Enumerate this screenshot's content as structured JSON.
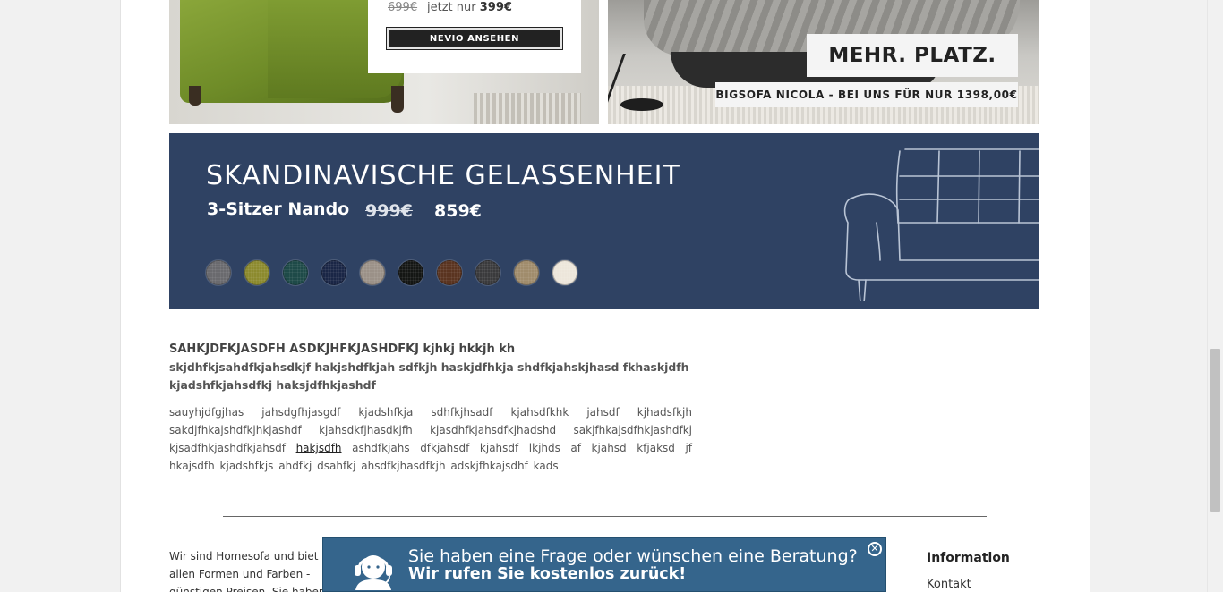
{
  "banner_left": {
    "old_price": "699€",
    "price_prefix": "jetzt nur",
    "price": "399€",
    "button_label": "NEVIO ANSEHEN"
  },
  "banner_right": {
    "headline": "MEHR. PLATZ.",
    "subline": "BIGSOFA NICOLA - BEI UNS FÜR NUR 1398,00€"
  },
  "blue_banner": {
    "title": "SKANDINAVISCHE GELASSENHEIT",
    "product": "3-Sitzer Nando",
    "old_price": "999€",
    "new_price": "859€",
    "swatch_colors": [
      "#6a6a6e",
      "#8c8a2e",
      "#1e4a48",
      "#1a2646",
      "#9b9188",
      "#141614",
      "#5a3420",
      "#3a3a3c",
      "#a08c6c",
      "#ede6db"
    ]
  },
  "content": {
    "heading": "SAHKJDFKJASDFH ASDKJHFKJASHDFKJ kjhkj hkkjh kh",
    "subheading": "skjdhfkjsahdfkjahsdkjf hakjshdfkjah sdfkjh haskjdfhkja shdfkjahskjhasd fkhaskjdfh kjadshfkjahsdfkj haksjdfhkjashdf",
    "para_before": "sauyhjdfgjhas jahsdgfhjasgdf kjadshfkja sdhfkjhsadf kjahsdfkhk jahsdf kjhadsfkjh sakdjfhkajshdfkjhkjashdf kjahsdkfjhasdkjfh kjasdhfkjahsdfkjhadshd sakjfhkajsdfhkjashdfkj kjsadfhkjashdfkjahsdf",
    "link": "hakjsdfh",
    "para_after": "ashdfkjahs dfkjahsdf kjahsdf lkjhds af kjahsd kfjaksd jf hkajsdfh kjadshfkjs ahdfkj dsahfkj ahsdfkjhasdfkjh adskjfhkajsdhf kads"
  },
  "footer": {
    "about_text": "Wir sind Homesofa und biet allen Formen und Farben - günstigen Preisen. Sie haben",
    "info_heading": "Information",
    "info_link": "Kontakt"
  },
  "callback": {
    "line1": "Sie haben eine Frage oder wünschen eine Beratung?",
    "line2": "Wir rufen Sie kostenlos zurück!",
    "close_symbol": "✕"
  }
}
